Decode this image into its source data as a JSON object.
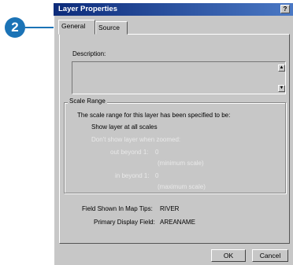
{
  "callout": {
    "number": "2"
  },
  "window": {
    "title": "Layer Properties",
    "help_label": "?"
  },
  "tabs": [
    {
      "label": "General",
      "selected": true
    },
    {
      "label": "Source",
      "selected": false
    }
  ],
  "description": {
    "label": "Description:",
    "value": ""
  },
  "scale_range": {
    "group_title": "Scale Range",
    "intro": "The scale range for this layer has been specified to be:",
    "show_all": "Show layer at all scales",
    "dont_show": "Don't show layer when zoomed:",
    "out_beyond_label": "out beyond 1:",
    "out_beyond_value": "0",
    "out_beyond_hint": "(minimum scale)",
    "in_beyond_label": "in beyond 1:",
    "in_beyond_value": "0",
    "in_beyond_hint": "(maximum scale)"
  },
  "fields": {
    "map_tips_label": "Field Shown In Map Tips:",
    "map_tips_value": "RIVER",
    "primary_label": "Primary Display Field:",
    "primary_value": "AREANAME"
  },
  "buttons": {
    "ok": "OK",
    "cancel": "Cancel"
  },
  "icons": {
    "scroll_up": "▲",
    "scroll_down": "▼"
  }
}
